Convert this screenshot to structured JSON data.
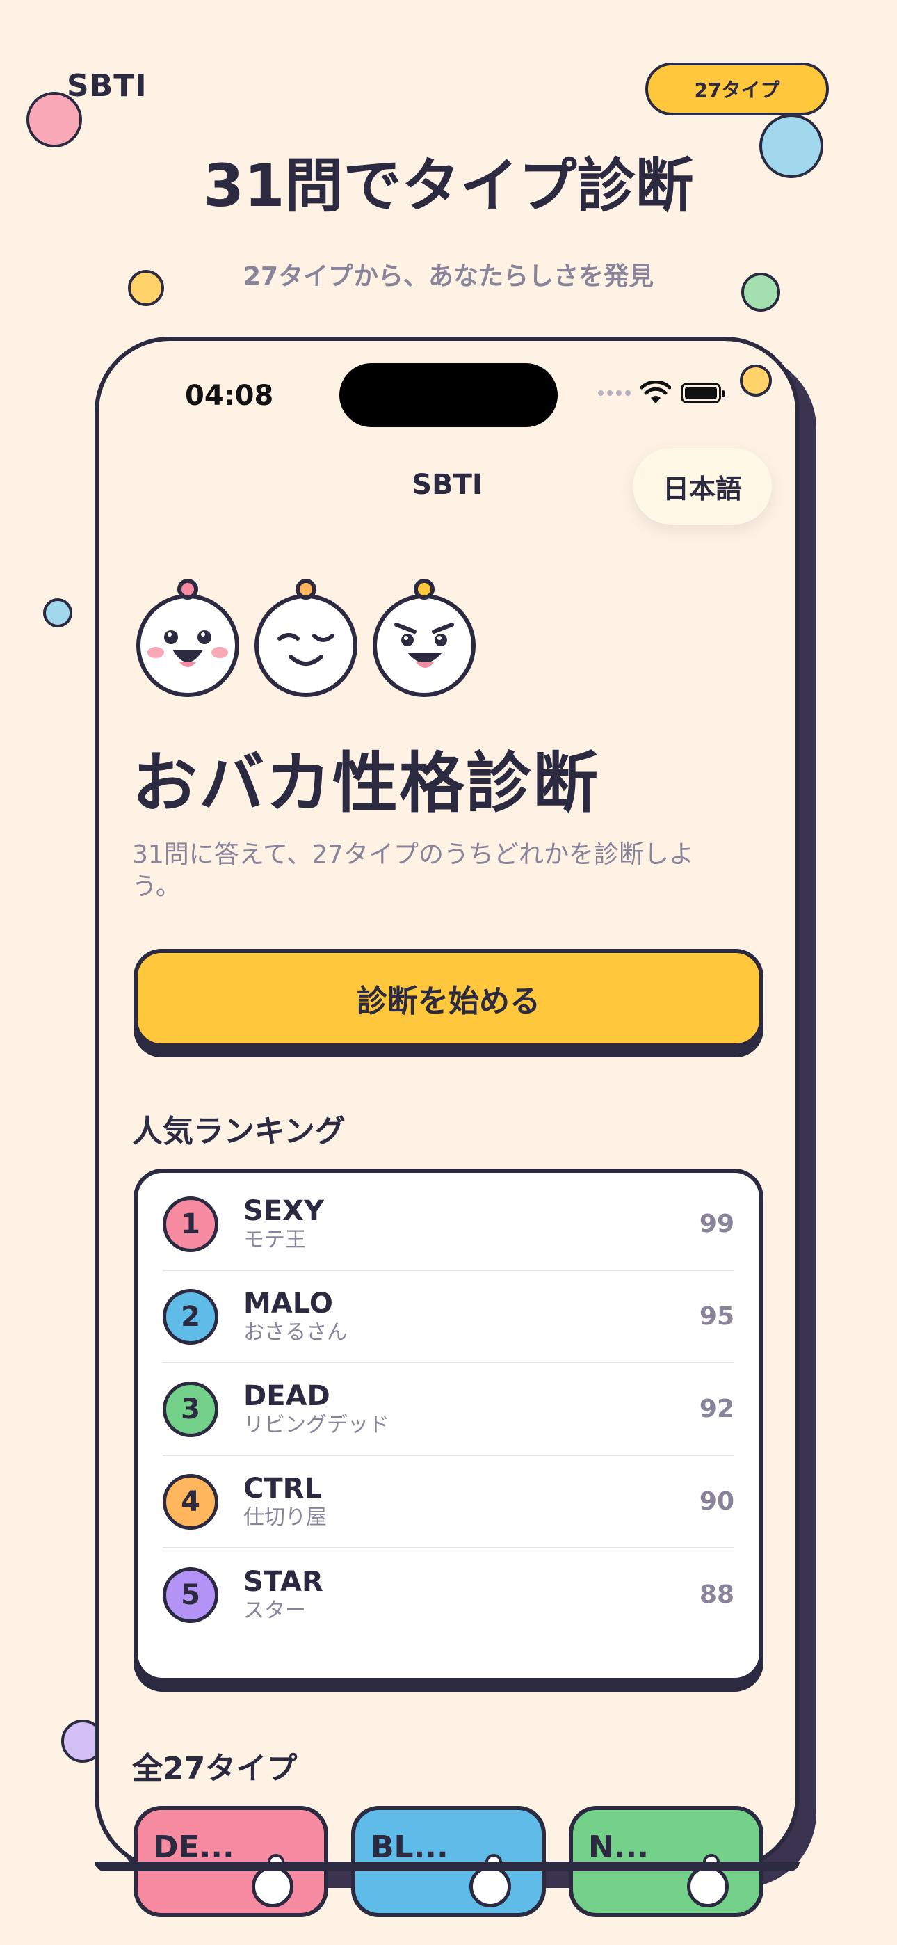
{
  "promo": {
    "brand": "SBTI",
    "badge": "27タイプ",
    "headline": "31問でタイプ診断",
    "subheadline": "27タイプから、あなたらしさを発見"
  },
  "status_bar": {
    "time": "04:08"
  },
  "nav": {
    "title": "SBTI",
    "language": "日本語"
  },
  "app": {
    "title": "おバカ性格診断",
    "description": "31問に答えて、27タイプのうちどれかを診断しよう。",
    "start_button": "診断を始める"
  },
  "ranking": {
    "title": "人気ランキング",
    "items": [
      {
        "rank": "1",
        "code": "SEXY",
        "name": "モテ王",
        "score": "99",
        "color": "#f78ba2"
      },
      {
        "rank": "2",
        "code": "MALO",
        "name": "おさるさん",
        "score": "95",
        "color": "#5fbce8"
      },
      {
        "rank": "3",
        "code": "DEAD",
        "name": "リビングデッド",
        "score": "92",
        "color": "#74d18a"
      },
      {
        "rank": "4",
        "code": "CTRL",
        "name": "仕切り屋",
        "score": "90",
        "color": "#ffb65c"
      },
      {
        "rank": "5",
        "code": "STAR",
        "name": "スター",
        "score": "88",
        "color": "#b393f5"
      }
    ]
  },
  "all_types": {
    "title": "全27タイプ",
    "tiles": [
      {
        "label": "DE...",
        "color": "#f78ba2"
      },
      {
        "label": "BL...",
        "color": "#5fbce8"
      },
      {
        "label": "N...",
        "color": "#74d18a"
      }
    ]
  },
  "icons": [
    "wifi-icon",
    "battery-icon",
    "signal-dots-icon",
    "face-happy-icon",
    "face-wink-icon",
    "face-mischief-icon"
  ]
}
